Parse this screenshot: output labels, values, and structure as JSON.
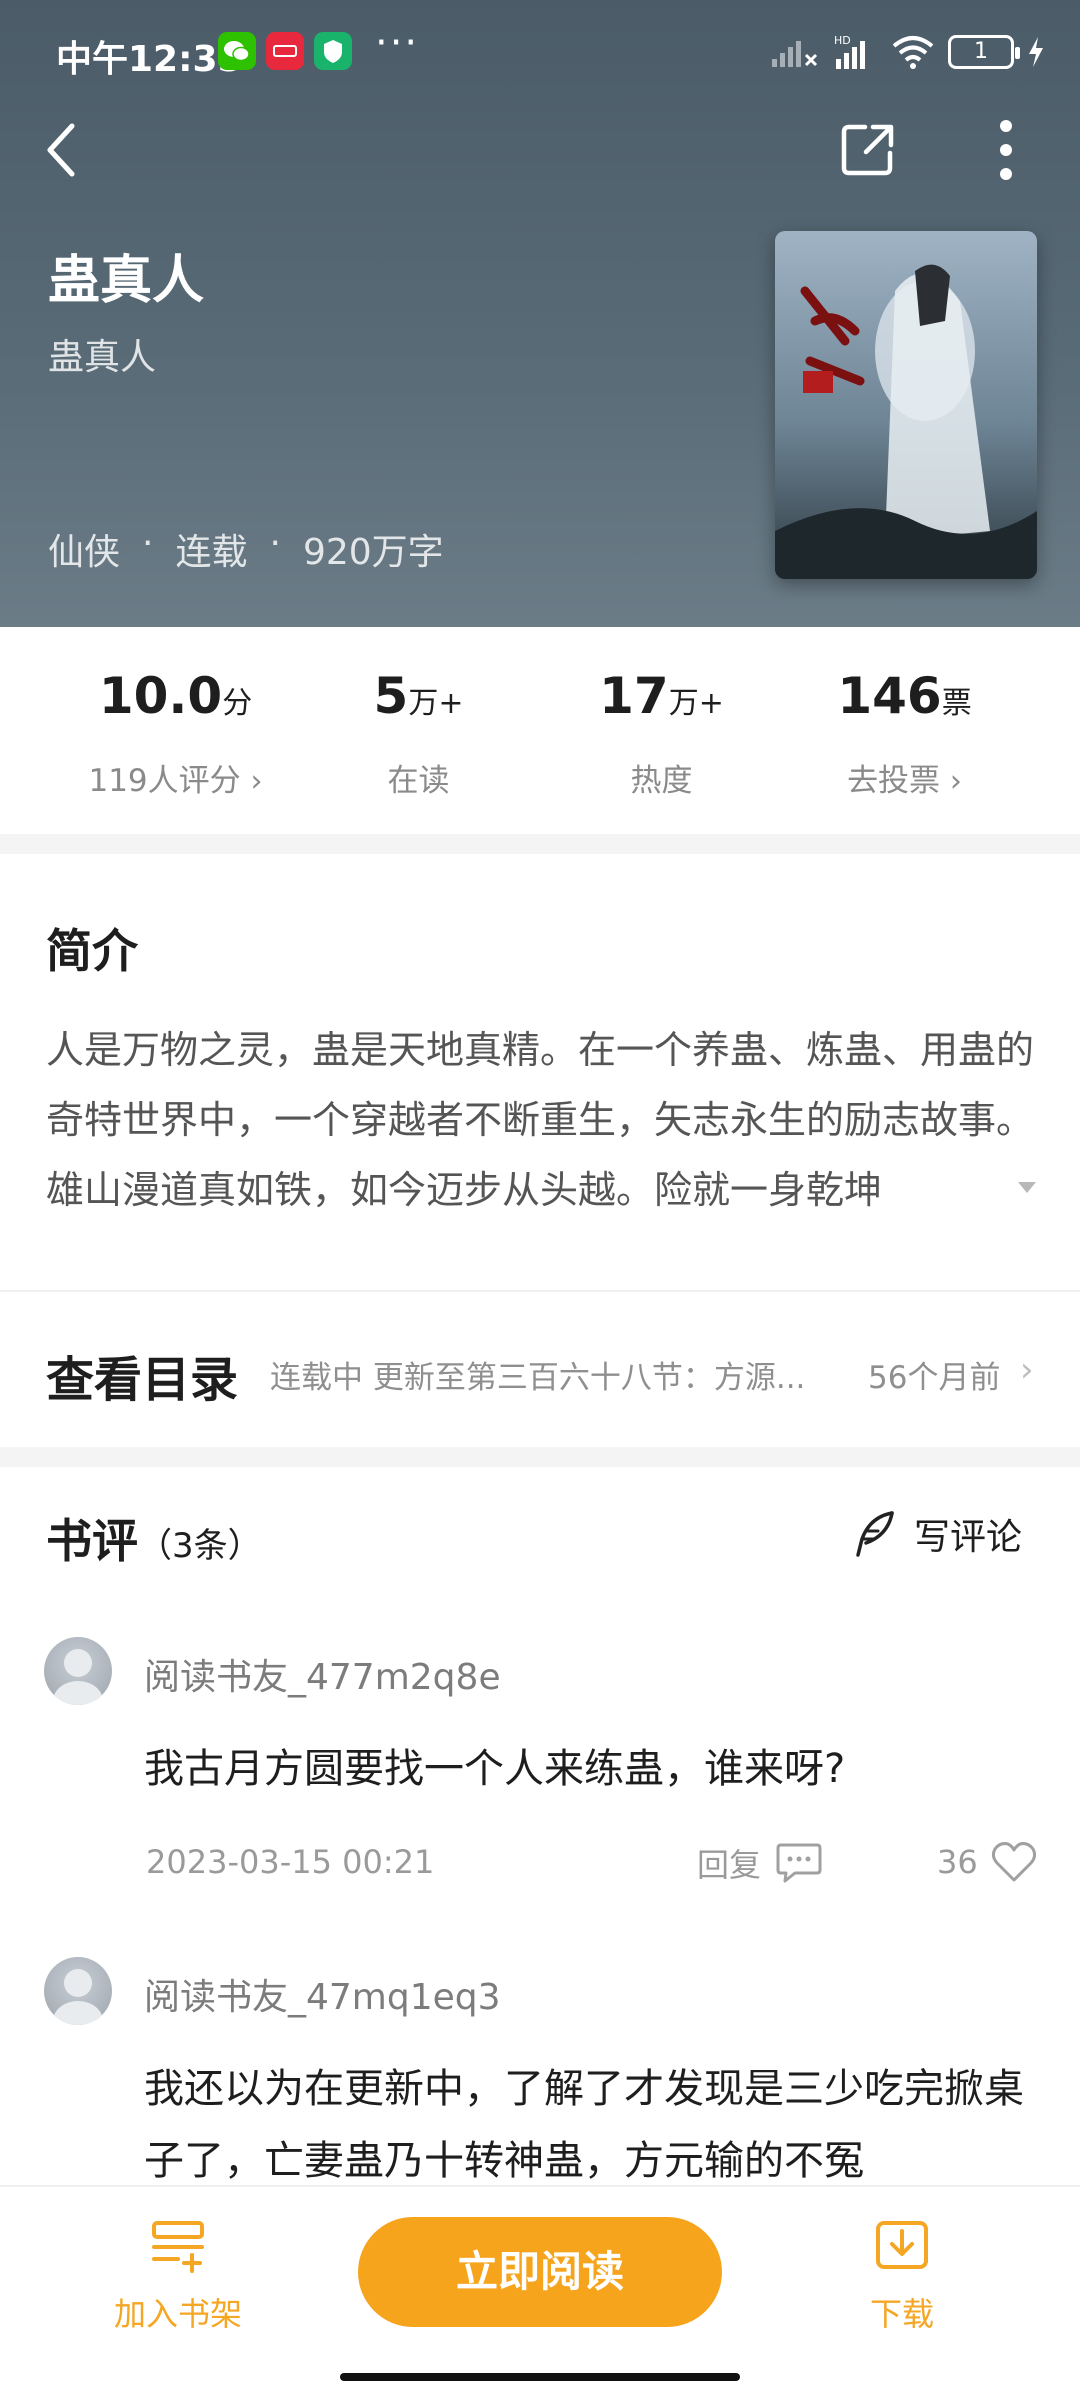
{
  "status_bar": {
    "time": "中午12:35",
    "battery": "1"
  },
  "book": {
    "title": "蛊真人",
    "author": "蛊真人",
    "meta": [
      "仙侠",
      "·",
      "连载",
      "·",
      "920万字"
    ]
  },
  "stats": [
    {
      "value": "10.0",
      "unit": "分",
      "label": "119人评分",
      "chevron": true
    },
    {
      "value": "5",
      "unit": "万+",
      "label": "在读",
      "chevron": false
    },
    {
      "value": "17",
      "unit": "万+",
      "label": "热度",
      "chevron": false
    },
    {
      "value": "146",
      "unit": "票",
      "label": "去投票",
      "chevron": true
    }
  ],
  "intro": {
    "title": "简介",
    "text": "人是万物之灵，蛊是天地真精。在一个养蛊、炼蛊、用蛊的奇特世界中，一个穿越者不断重生，矢志永生的励志故事。雄山漫道真如铁，如今迈步从头越。险就一身乾坤"
  },
  "catalog": {
    "title": "查看目录",
    "latest": "连载中 更新至第三百六十八节：方源...",
    "time": "56个月前"
  },
  "reviews_section": {
    "title": "书评",
    "count": "（3条）",
    "write_label": "写评论"
  },
  "reviews": [
    {
      "user": "阅读书友_477m2q8e",
      "body": "我古月方圆要找一个人来练蛊，谁来呀?",
      "date": "2023-03-15 00:21",
      "reply_label": "回复",
      "likes": "36"
    },
    {
      "user": "阅读书友_47mq1eq3",
      "body": "我还以为在更新中，了解了才发现是三少吃完掀桌子了，亡妻蛊乃十转神蛊，方元输的不冤"
    }
  ],
  "bottom_bar": {
    "shelf_label": "加入书架",
    "read_label": "立即阅读",
    "download_label": "下载"
  },
  "colors": {
    "accent": "#f7a41d",
    "header_bg": "#556773"
  }
}
